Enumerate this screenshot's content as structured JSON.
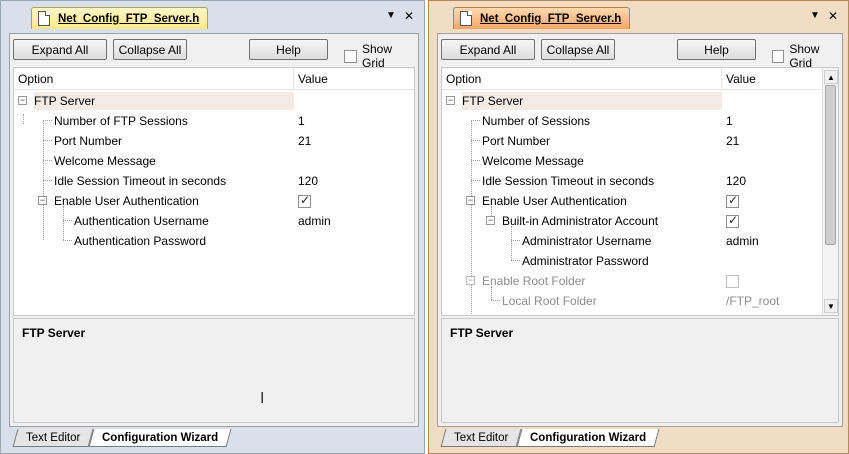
{
  "panels": [
    {
      "tab_title": "Net_Config_FTP_Server.h",
      "toolbar": {
        "expand_all": "Expand All",
        "collapse_all": "Collapse All",
        "help": "Help",
        "show_grid": "Show Grid",
        "show_grid_checked": false
      },
      "columns": {
        "option": "Option",
        "value": "Value"
      },
      "rows": [
        {
          "label": "FTP Server",
          "value": ""
        },
        {
          "label": "Number of FTP Sessions",
          "value": "1"
        },
        {
          "label": "Port Number",
          "value": "21"
        },
        {
          "label": "Welcome Message",
          "value": ""
        },
        {
          "label": "Idle Session Timeout in seconds",
          "value": "120"
        },
        {
          "label": "Enable User Authentication",
          "checked": true
        },
        {
          "label": "Authentication Username",
          "value": "admin"
        },
        {
          "label": "Authentication Password",
          "value": ""
        }
      ],
      "description_title": "FTP Server",
      "bottom_tabs": [
        "Text Editor",
        "Configuration Wizard"
      ]
    },
    {
      "tab_title": "Net_Config_FTP_Server.h",
      "toolbar": {
        "expand_all": "Expand All",
        "collapse_all": "Collapse All",
        "help": "Help",
        "show_grid": "Show Grid",
        "show_grid_checked": false
      },
      "columns": {
        "option": "Option",
        "value": "Value"
      },
      "rows": [
        {
          "label": "FTP Server",
          "value": ""
        },
        {
          "label": "Number of Sessions",
          "value": "1"
        },
        {
          "label": "Port Number",
          "value": "21"
        },
        {
          "label": "Welcome Message",
          "value": ""
        },
        {
          "label": "Idle Session Timeout in seconds",
          "value": "120"
        },
        {
          "label": "Enable User Authentication",
          "checked": true
        },
        {
          "label": "Built-in Administrator Account",
          "checked": true
        },
        {
          "label": "Administrator Username",
          "value": "admin"
        },
        {
          "label": "Administrator Password",
          "value": ""
        },
        {
          "label": "Enable Root Folder",
          "checked": false,
          "disabled": true
        },
        {
          "label": "Local Root Folder",
          "value": "/FTP_root",
          "disabled": true
        }
      ],
      "description_title": "FTP Server",
      "bottom_tabs": [
        "Text Editor",
        "Configuration Wizard"
      ]
    }
  ]
}
